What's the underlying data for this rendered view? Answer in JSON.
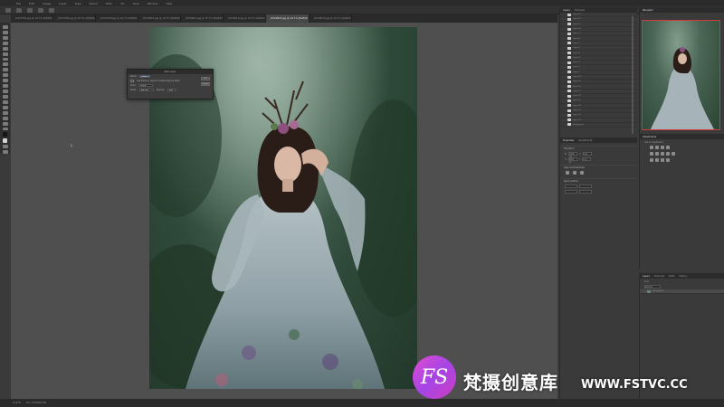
{
  "menubar": {
    "items": [
      "File",
      "Edit",
      "Image",
      "Layer",
      "Type",
      "Select",
      "Filter",
      "3D",
      "View",
      "Window",
      "Help"
    ]
  },
  "doc_tabs": [
    {
      "label": "_DSC0781.jpg @ 16.7% (RGB/8)",
      "active": false
    },
    {
      "label": "_DSC0782.jpg @ 16.7% (RGB/8)",
      "active": false
    },
    {
      "label": "_DSC0790.jpg @ 16.7% (RGB/8)",
      "active": false
    },
    {
      "label": "_DSC0801.jpg @ 16.7% (RGB/8)",
      "active": false
    },
    {
      "label": "_DSC0812.jpg @ 16.7% (RGB/8)",
      "active": false
    },
    {
      "label": "_DSC0819.jpg @ 16.7% (RGB/8)",
      "active": false
    },
    {
      "label": "_DSC0825.jpg @ 16.7% (RGB/8)",
      "active": true
    },
    {
      "label": "_DSC0833.jpg @ 16.7% (RGB/8)",
      "active": false
    }
  ],
  "dialog": {
    "title": "New Layer",
    "name_label": "Name:",
    "name_value": "Layer 1",
    "option_text": "Use Previous Layer to Create Clipping Mask",
    "color_label": "Color:",
    "color_value": "None",
    "mode_label": "Mode:",
    "mode_value": "Normal",
    "opacity_label": "Opacity:",
    "opacity_value": "100",
    "ok_label": "OK",
    "cancel_label": "Cancel"
  },
  "layers_panel_top": {
    "tabs": [
      "Layers",
      "Channels"
    ],
    "rows": [
      "Layer 13",
      "Layer 12",
      "Layer 11",
      "Layer 10",
      "Layer 9",
      "Layer 8",
      "Layer 7",
      "Layer 6",
      "Layer 5",
      "Layer 4",
      "Layer 3",
      "Layer 2",
      "Layer 1",
      "Layer 14",
      "Layer 15",
      "Layer 16",
      "Layer 17",
      "Layer 18",
      "Layer 19",
      "Layer 20",
      "Layer 21",
      "Layer 22",
      "Layer 23",
      "Background"
    ]
  },
  "navigator": {
    "tab": "Navigator"
  },
  "properties": {
    "tabs": [
      "Properties",
      "Adjustments"
    ],
    "section_transform": "Transform",
    "section_align": "Align and Distribute",
    "section_quick": "Quick Actions",
    "w_value": "2926 px",
    "h_value": "4000 px",
    "x_value": "0 px",
    "y_value": "0 px"
  },
  "adjustments": {
    "tab": "Adjustments",
    "add_label": "Add an adjustment"
  },
  "layers_bottom": {
    "tabs": [
      "Layers",
      "Channels",
      "Paths",
      "History"
    ],
    "kind_label": "Kind",
    "blend": "Normal",
    "layer_name": "Background"
  },
  "status": {
    "zoom": "16.67%",
    "doc_info": "Doc: 33.5M/33.5M"
  },
  "watermark": {
    "logo_text": "FS",
    "cn_text": "梵摄创意库",
    "url": "WWW.FSTVC.CC"
  }
}
